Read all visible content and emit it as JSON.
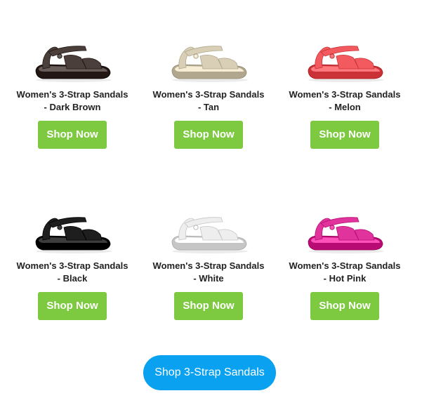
{
  "products": [
    {
      "title": "Women's 3-Strap Sandals",
      "variant": "- Dark Brown",
      "button": "Shop Now",
      "color": "#4a3f3a",
      "icon": "sandal-dark-brown-image"
    },
    {
      "title": "Women's 3-Strap Sandals",
      "variant": "- Tan",
      "button": "Shop Now",
      "color": "#d8cfb6",
      "icon": "sandal-tan-image"
    },
    {
      "title": "Women's 3-Strap Sandals",
      "variant": "- Melon",
      "button": "Shop Now",
      "color": "#f25a5f",
      "icon": "sandal-melon-image"
    },
    {
      "title": "Women's 3-Strap Sandals",
      "variant": "- Black",
      "button": "Shop Now",
      "color": "#1e1e1e",
      "icon": "sandal-black-image"
    },
    {
      "title": "Women's 3-Strap Sandals",
      "variant": "- White",
      "button": "Shop Now",
      "color": "#eeeeee",
      "icon": "sandal-white-image"
    },
    {
      "title": "Women's 3-Strap Sandals",
      "variant": "- Hot Pink",
      "button": "Shop Now",
      "color": "#e0349c",
      "icon": "sandal-hot-pink-image"
    }
  ],
  "cta": {
    "label": "Shop 3-Strap Sandals"
  },
  "colors": {
    "shop_button": "#7dc93f",
    "cta_button": "#0aa2f0",
    "title_text": "#222222"
  }
}
